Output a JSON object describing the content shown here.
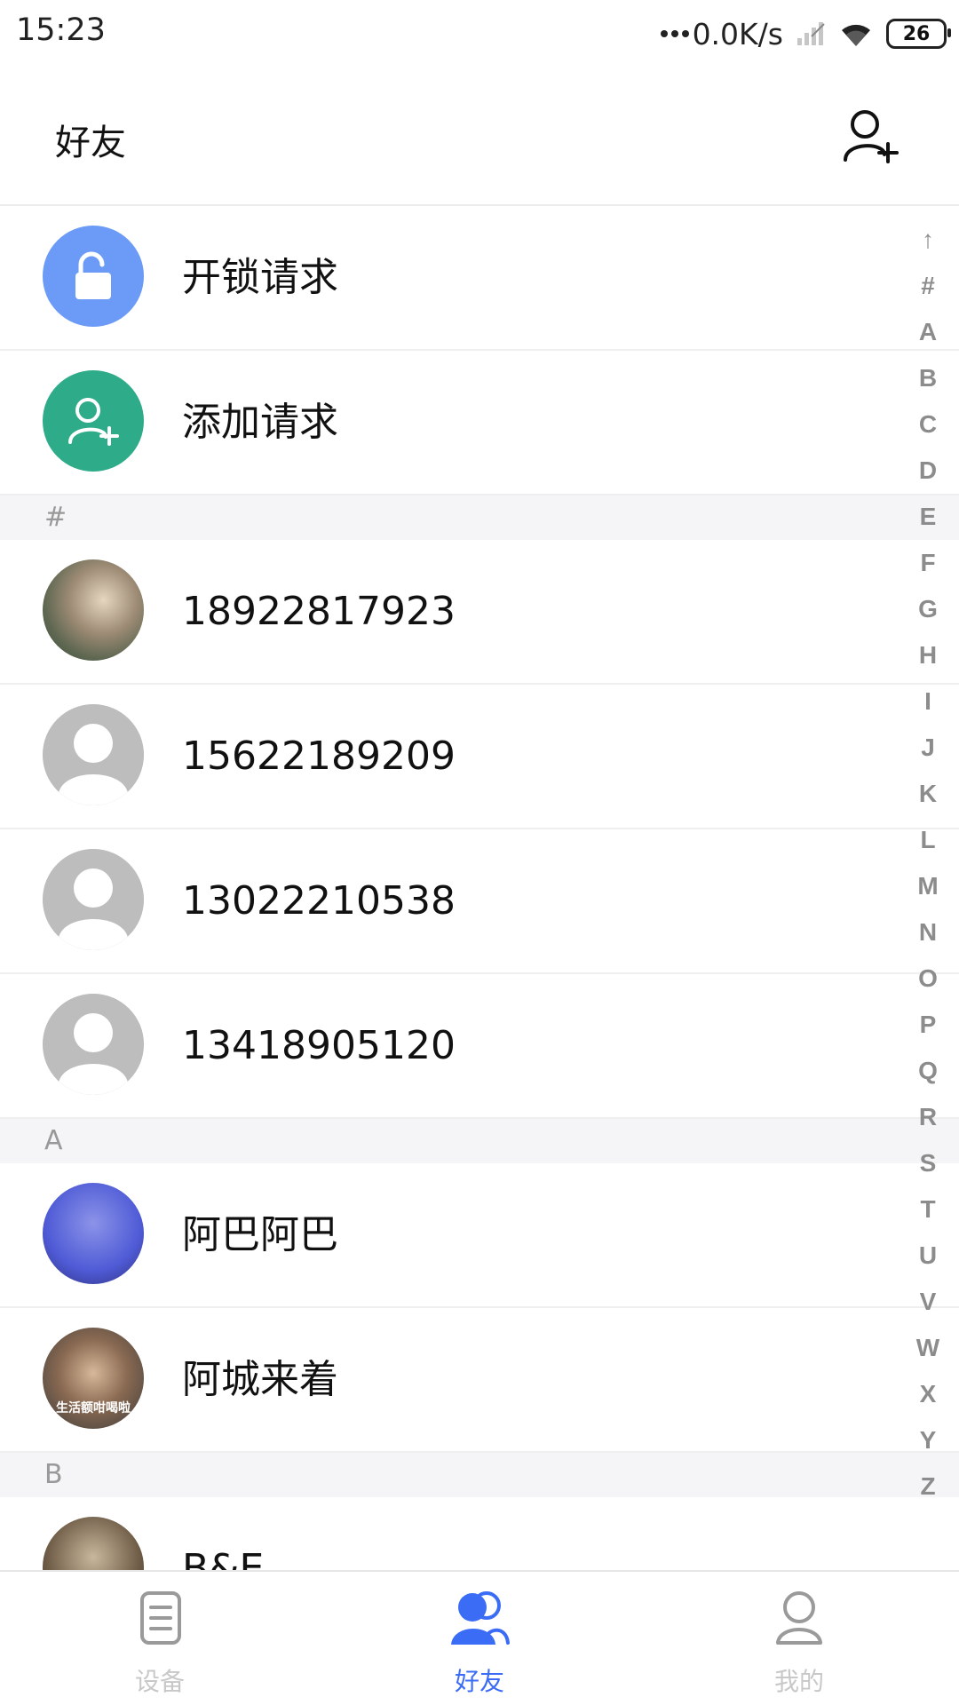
{
  "status_bar": {
    "time": "15:23",
    "net_speed": "0.0K/s",
    "battery": "26"
  },
  "header": {
    "title": "好友",
    "add_icon": "add-user-icon"
  },
  "requests": [
    {
      "label": "开锁请求",
      "icon": "unlock-icon",
      "color": "#6b9bf6"
    },
    {
      "label": "添加请求",
      "icon": "add-user-icon",
      "color": "#2eab89"
    }
  ],
  "sections": [
    {
      "header": "#",
      "contacts": [
        {
          "label": "18922817923",
          "avatar": "photo"
        },
        {
          "label": "15622189209",
          "avatar": "default"
        },
        {
          "label": "13022210538",
          "avatar": "default"
        },
        {
          "label": "13418905120",
          "avatar": "default"
        }
      ]
    },
    {
      "header": "A",
      "contacts": [
        {
          "label": "阿巴阿巴",
          "avatar": "photo"
        },
        {
          "label": "阿城来着",
          "avatar": "photo",
          "avatar_caption": "生活额咁喝啦"
        }
      ]
    },
    {
      "header": "B",
      "contacts": [
        {
          "label": "B&E",
          "avatar": "photo"
        }
      ]
    }
  ],
  "alpha_index": [
    "↑",
    "#",
    "A",
    "B",
    "C",
    "D",
    "E",
    "F",
    "G",
    "H",
    "I",
    "J",
    "K",
    "L",
    "M",
    "N",
    "O",
    "P",
    "Q",
    "R",
    "S",
    "T",
    "U",
    "V",
    "W",
    "X",
    "Y",
    "Z"
  ],
  "bottom_nav": [
    {
      "label": "设备",
      "icon": "device-list-icon",
      "active": false
    },
    {
      "label": "好友",
      "icon": "friends-icon",
      "active": true
    },
    {
      "label": "我的",
      "icon": "profile-icon",
      "active": false
    }
  ],
  "colors": {
    "accent": "#3b6cf6",
    "unlock": "#6b9bf6",
    "add": "#2eab89"
  }
}
